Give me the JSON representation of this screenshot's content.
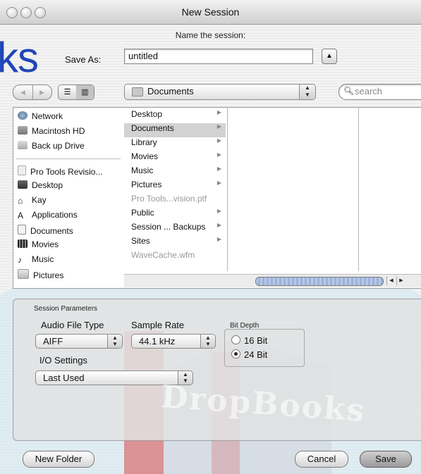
{
  "window": {
    "title": "New Session"
  },
  "prompt": "Name the session:",
  "save_as": {
    "label": "Save As:",
    "value": "untitled"
  },
  "toolbar": {
    "location": "Documents",
    "search_placeholder": "search"
  },
  "sidebar": {
    "devices": [
      {
        "label": "Network",
        "icon": "globe-icon"
      },
      {
        "label": "Macintosh HD",
        "icon": "hard-drive-icon"
      },
      {
        "label": "Back up Drive",
        "icon": "external-drive-icon"
      }
    ],
    "places": [
      {
        "label": "Pro Tools Revisio...",
        "icon": "document-icon"
      },
      {
        "label": "Desktop",
        "icon": "desktop-icon"
      },
      {
        "label": "Kay",
        "icon": "home-icon"
      },
      {
        "label": "Applications",
        "icon": "applications-icon"
      },
      {
        "label": "Documents",
        "icon": "documents-folder-icon"
      },
      {
        "label": "Movies",
        "icon": "movies-folder-icon"
      },
      {
        "label": "Music",
        "icon": "music-folder-icon"
      },
      {
        "label": "Pictures",
        "icon": "pictures-folder-icon"
      }
    ]
  },
  "browser": {
    "column1": [
      {
        "label": "Desktop",
        "folder": true,
        "selected": false,
        "dim": false
      },
      {
        "label": "Documents",
        "folder": true,
        "selected": true,
        "dim": false
      },
      {
        "label": "Library",
        "folder": true,
        "selected": false,
        "dim": false
      },
      {
        "label": "Movies",
        "folder": true,
        "selected": false,
        "dim": false
      },
      {
        "label": "Music",
        "folder": true,
        "selected": false,
        "dim": false
      },
      {
        "label": "Pictures",
        "folder": true,
        "selected": false,
        "dim": false
      },
      {
        "label": "Pro Tools...vision.ptf",
        "folder": false,
        "selected": false,
        "dim": true
      },
      {
        "label": "Public",
        "folder": true,
        "selected": false,
        "dim": false
      },
      {
        "label": "Session ... Backups",
        "folder": true,
        "selected": false,
        "dim": false
      },
      {
        "label": "Sites",
        "folder": true,
        "selected": false,
        "dim": false
      },
      {
        "label": "WaveCache.wfm",
        "folder": false,
        "selected": false,
        "dim": true
      }
    ]
  },
  "session_parameters": {
    "group_label": "Session Parameters",
    "audio_file_type": {
      "label": "Audio File Type",
      "value": "AIFF"
    },
    "sample_rate": {
      "label": "Sample Rate",
      "value": "44.1 kHz"
    },
    "io_settings": {
      "label": "I/O Settings",
      "value": "Last Used"
    },
    "bit_depth": {
      "label": "Bit Depth",
      "options": [
        {
          "label": "16 Bit",
          "selected": false
        },
        {
          "label": "24 Bit",
          "selected": true
        }
      ]
    }
  },
  "buttons": {
    "new_folder": "New Folder",
    "cancel": "Cancel",
    "save": "Save"
  },
  "watermarks": {
    "top_left": "ks",
    "center": "DropBooks"
  }
}
